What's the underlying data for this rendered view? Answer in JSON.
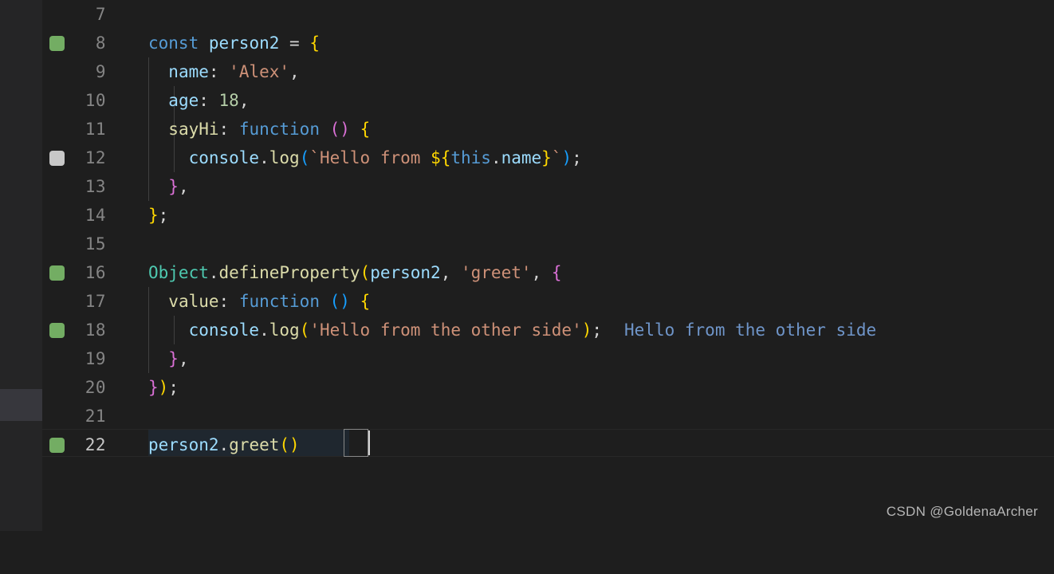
{
  "editor": {
    "language": "javascript",
    "theme": "Dark+ (default dark)",
    "line_height_px": 36,
    "first_visible_line": 7,
    "last_visible_line": 22,
    "active_line": 22,
    "colors": {
      "background": "#1e1e1e",
      "gutter_background": "#252526",
      "line_number": "#858585",
      "line_number_active": "#c6c6c6",
      "indent_guide": "#404040",
      "scrollbar_thumb": "#37373d",
      "marker_green": "#73ad63",
      "marker_grey": "#c8c8c8",
      "keyword": "#569cd6",
      "variable": "#9cdcfe",
      "class": "#4ec9b0",
      "function": "#dcdcaa",
      "string": "#ce9178",
      "number": "#b5cea8",
      "plain": "#d4d4d4",
      "bracket_yellow": "#ffd700",
      "bracket_pink": "#da70d6",
      "bracket_blue": "#179fff",
      "inline_output": "#6f95c9",
      "bracket_match_border": "#888888",
      "cursor": "#d4d4d4"
    },
    "lines": [
      {
        "number": "7",
        "marker": "none",
        "text": ""
      },
      {
        "number": "8",
        "marker": "green",
        "text": "const person2 = {"
      },
      {
        "number": "9",
        "marker": "none",
        "text": "  name: 'Alex',"
      },
      {
        "number": "10",
        "marker": "none",
        "text": "  age: 18,"
      },
      {
        "number": "11",
        "marker": "none",
        "text": "  sayHi: function () {"
      },
      {
        "number": "12",
        "marker": "grey",
        "text": "    console.log(`Hello from ${this.name}`);"
      },
      {
        "number": "13",
        "marker": "none",
        "text": "  },"
      },
      {
        "number": "14",
        "marker": "none",
        "text": "};"
      },
      {
        "number": "15",
        "marker": "none",
        "text": ""
      },
      {
        "number": "16",
        "marker": "green",
        "text": "Object.defineProperty(person2, 'greet', {"
      },
      {
        "number": "17",
        "marker": "none",
        "text": "  value: function () {"
      },
      {
        "number": "18",
        "marker": "green",
        "text": "    console.log('Hello from the other side');"
      },
      {
        "number": "19",
        "marker": "none",
        "text": "  },"
      },
      {
        "number": "20",
        "marker": "none",
        "text": "});"
      },
      {
        "number": "21",
        "marker": "none",
        "text": ""
      },
      {
        "number": "22",
        "marker": "green",
        "text": "person2.greet()"
      }
    ],
    "inline_output": {
      "line": "18",
      "text": "Hello from the other side"
    },
    "tokens": {
      "l8": {
        "kw": "const",
        "sp1": " ",
        "var": "person2",
        "eq": " = ",
        "brace": "{"
      },
      "l9": {
        "indent": "  ",
        "key": "name",
        "colon": ": ",
        "str": "'Alex'",
        "comma": ","
      },
      "l10": {
        "indent": "  ",
        "key": "age",
        "colon": ": ",
        "num": "18",
        "comma": ","
      },
      "l11": {
        "indent": "  ",
        "key": "sayHi",
        "colon": ": ",
        "kw": "function",
        "sp": " ",
        "parens": "()",
        "sp2": " ",
        "brace": "{"
      },
      "l12": {
        "indent": "    ",
        "obj": "console",
        "dot": ".",
        "fn": "log",
        "open": "(",
        "str1": "`Hello from ",
        "tpl_open": "${",
        "kw_this": "this",
        "dot2": ".",
        "prop": "name",
        "tpl_close": "}",
        "str2": "`",
        "close": ")",
        "semi": ";"
      },
      "l13": {
        "indent": "  ",
        "brace": "}",
        "comma": ","
      },
      "l14": {
        "brace": "}",
        "semi": ";"
      },
      "l16": {
        "cls": "Object",
        "dot": ".",
        "fn": "defineProperty",
        "open": "(",
        "var": "person2",
        "comma1": ", ",
        "str": "'greet'",
        "comma2": ", ",
        "brace": "{"
      },
      "l17": {
        "indent": "  ",
        "key": "value",
        "colon": ": ",
        "kw": "function",
        "sp": " ",
        "parens": "()",
        "sp2": " ",
        "brace": "{"
      },
      "l18": {
        "indent": "    ",
        "obj": "console",
        "dot": ".",
        "fn": "log",
        "open": "(",
        "str": "'Hello from the other side'",
        "close": ")",
        "semi": ";"
      },
      "l19": {
        "indent": "  ",
        "brace": "}",
        "comma": ","
      },
      "l20": {
        "brace": "}",
        "paren": ")",
        "semi": ";"
      },
      "l22": {
        "var": "person2",
        "dot": ".",
        "fn": "greet",
        "open": "(",
        "close": ")"
      }
    }
  },
  "watermark": {
    "text": "CSDN @GoldenaArcher"
  }
}
